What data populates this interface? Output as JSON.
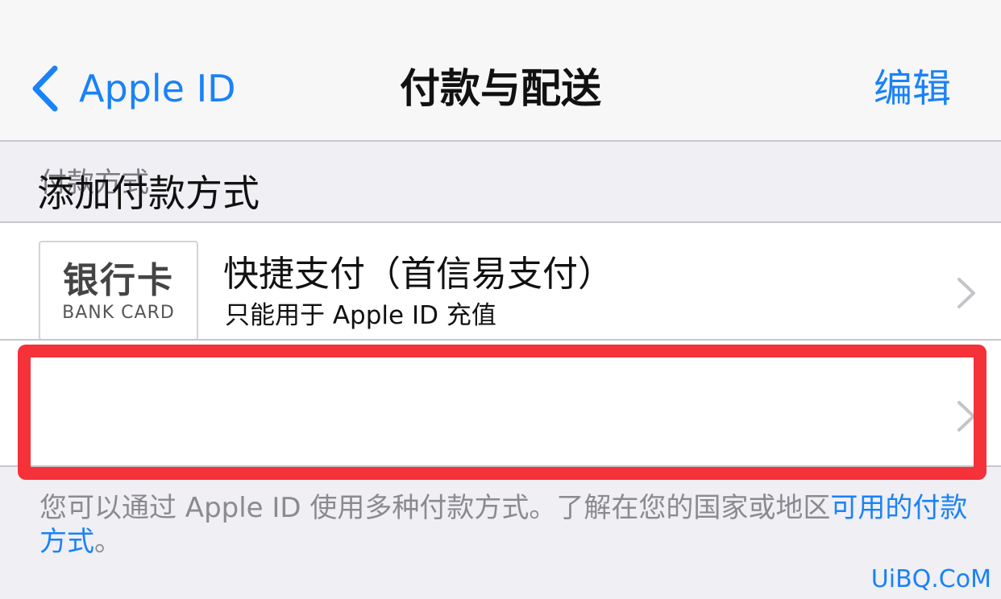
{
  "nav": {
    "back_label": "Apple ID",
    "title": "付款与配送",
    "edit_label": "编辑"
  },
  "section": {
    "header": "付款方式"
  },
  "payment_method": {
    "logo_cn": "银行卡",
    "logo_en": "BANK CARD",
    "title": "快捷支付（首信易支付）",
    "subtitle": "只能用于 Apple ID 充值"
  },
  "add_row": {
    "label": "添加付款方式"
  },
  "footer": {
    "text": "您可以通过 Apple ID 使用多种付款方式。了解在您的国家或地区",
    "link": "可用的付款方式",
    "suffix": "。"
  },
  "watermark": "UiBQ.CoM",
  "colors": {
    "accent": "#1a82f7",
    "highlight": "#f5313a",
    "background": "#efeff4"
  },
  "icons": {
    "back": "chevron-left-icon",
    "disclosure": "chevron-right-icon"
  }
}
